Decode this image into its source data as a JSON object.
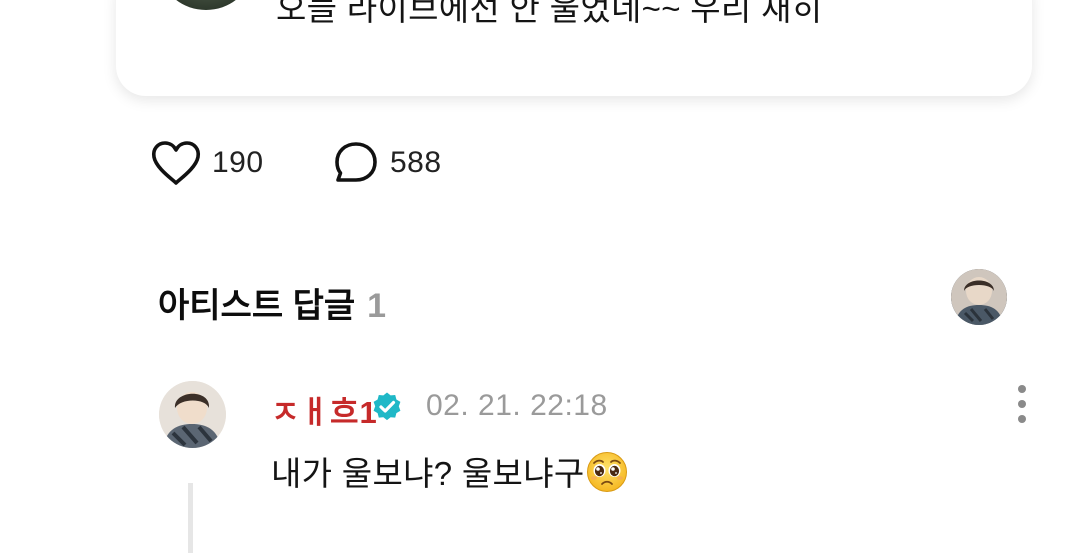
{
  "post": {
    "text": "오늘 라이브에선 안 울었네~~ 우리 재히"
  },
  "reactions": {
    "like_icon": "heart-outline-icon",
    "like_count": "190",
    "comment_icon": "speech-bubble-outline-icon",
    "comment_count": "588"
  },
  "artist_reply": {
    "title": "아티스트 답글",
    "count": "1"
  },
  "comment": {
    "author": "ㅈㅐ흐1",
    "verified_icon": "verified-badge-icon",
    "timestamp": "02. 21. 22:18",
    "text": "내가 울보냐? 울보냐구",
    "emoji": "pleading-face-emoji",
    "more_icon": "more-vertical-icon"
  },
  "colors": {
    "author": "#c62a2a",
    "verified": "#1fb8c7",
    "muted": "#9a9a9a"
  }
}
